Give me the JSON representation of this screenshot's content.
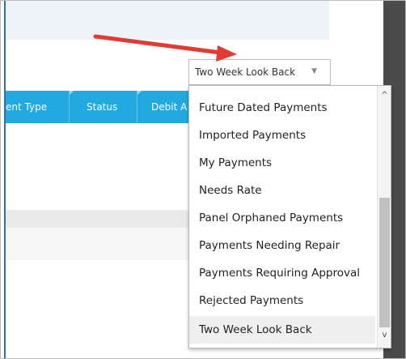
{
  "table": {
    "columns": [
      {
        "label": "ent Type"
      },
      {
        "label": "Status"
      },
      {
        "label": "Debit A"
      }
    ]
  },
  "filter": {
    "selected": "Two Week Look Back",
    "arrow_glyph": "▼",
    "options": [
      "Future Dated Payments",
      "Imported Payments",
      "My Payments",
      "Needs Rate",
      "Panel Orphaned Payments",
      "Payments Needing Repair",
      "Payments Requiring Approval",
      "Rejected Payments",
      "Two Week Look Back"
    ]
  },
  "scrollbar": {
    "up_glyph": "^",
    "down_glyph": "v"
  },
  "colors": {
    "header": "#22aae0",
    "annotation_arrow": "#e23b33",
    "side_panel": "#4a4a4a"
  }
}
